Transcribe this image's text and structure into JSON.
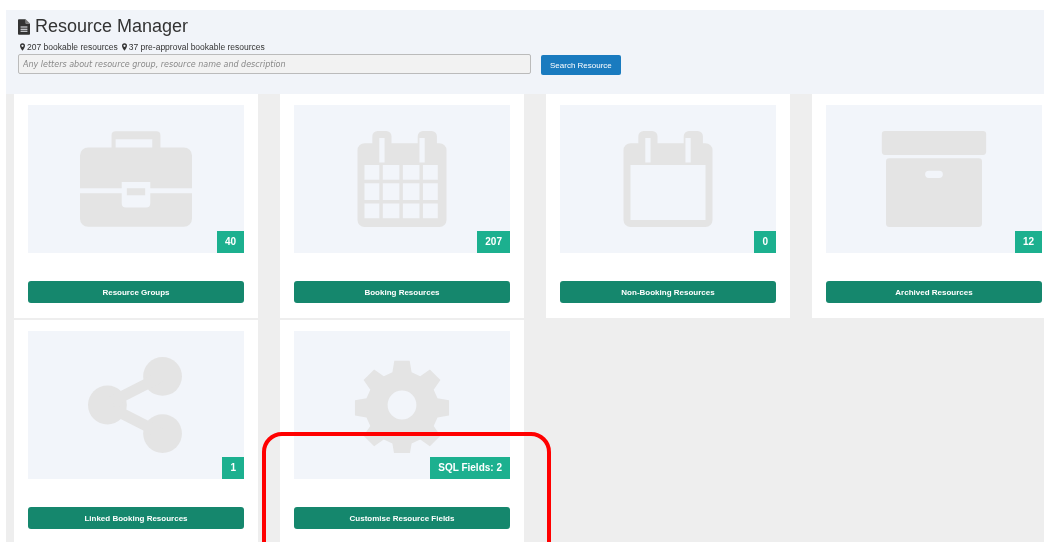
{
  "header": {
    "title": "Resource Manager",
    "stats": [
      "207 bookable resources",
      "37 pre-approval bookable resources"
    ],
    "search": {
      "placeholder": "Any letters about resource group, resource name and description"
    },
    "search_button": "Search Resource"
  },
  "cards": [
    {
      "badge": "40",
      "button": "Resource Groups",
      "highlighted": false
    },
    {
      "badge": "207",
      "button": "Booking Resources",
      "highlighted": false
    },
    {
      "badge": "0",
      "button": "Non-Booking Resources",
      "highlighted": false
    },
    {
      "badge": "12",
      "button": "Archived Resources",
      "highlighted": false
    },
    {
      "badge": "1",
      "button": "Linked Booking Resources",
      "highlighted": false
    },
    {
      "badge": "SQL Fields: 2",
      "button": "Customise Resource Fields",
      "highlighted": true
    }
  ]
}
